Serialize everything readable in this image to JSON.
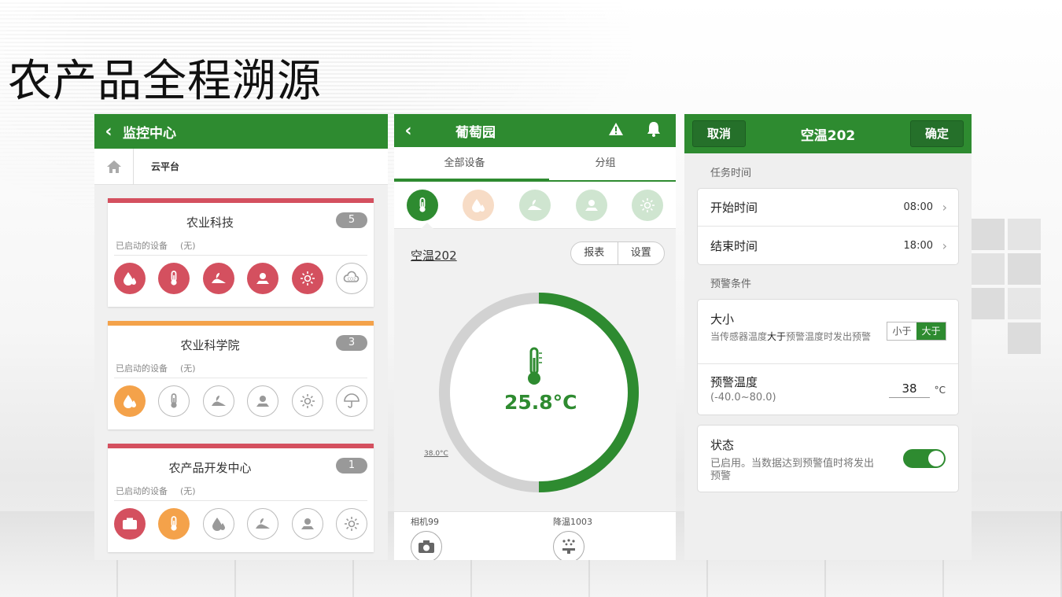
{
  "slide_title": "农产品全程溯源",
  "colors": {
    "brand_green": "#2e8b30",
    "alert_red": "#d4505f",
    "warn_orange": "#f4a24a",
    "idle_gray": "#bbbbbb"
  },
  "monitor": {
    "back_icon": "chevron-left-icon",
    "title": "监控中心",
    "breadcrumb": {
      "home_icon": "home-icon",
      "current": "云平台"
    },
    "orgs": [
      {
        "name": "农业科技",
        "count": "5",
        "sub_label": "已启动的设备",
        "sub_value": "(无)",
        "stripe": "#d4505f",
        "devices": [
          {
            "icon": "water-drop-icon",
            "state": "red"
          },
          {
            "icon": "thermometer-icon",
            "state": "red"
          },
          {
            "icon": "soil-icon",
            "state": "red"
          },
          {
            "icon": "plant-icon",
            "state": "red"
          },
          {
            "icon": "light-icon",
            "state": "red"
          },
          {
            "icon": "co2-icon",
            "state": "off"
          }
        ]
      },
      {
        "name": "农业科学院",
        "count": "3",
        "sub_label": "已启动的设备",
        "sub_value": "(无)",
        "stripe": "#f4a24a",
        "devices": [
          {
            "icon": "water-drop-icon",
            "state": "orange"
          },
          {
            "icon": "thermometer-icon",
            "state": "off"
          },
          {
            "icon": "soil-icon",
            "state": "off"
          },
          {
            "icon": "plant-icon",
            "state": "off"
          },
          {
            "icon": "light-icon",
            "state": "off"
          },
          {
            "icon": "umbrella-icon",
            "state": "off"
          }
        ]
      },
      {
        "name": "农产品开发中心",
        "count": "1",
        "sub_label": "已启动的设备",
        "sub_value": "(无)",
        "stripe": "#d4505f",
        "devices": [
          {
            "icon": "camera-icon",
            "state": "red"
          },
          {
            "icon": "thermometer-icon",
            "state": "orange"
          },
          {
            "icon": "water-drop-icon",
            "state": "off"
          },
          {
            "icon": "soil-icon",
            "state": "off"
          },
          {
            "icon": "plant-icon",
            "state": "off"
          },
          {
            "icon": "light-icon",
            "state": "off"
          }
        ]
      }
    ]
  },
  "garden": {
    "back_icon": "chevron-left-icon",
    "title": "葡萄园",
    "alert_icon": "warning-icon",
    "bell_icon": "bell-icon",
    "tabs": [
      "全部设备",
      "分组"
    ],
    "active_tab": 0,
    "device_icons": [
      {
        "icon": "thermometer-icon",
        "selected": true
      },
      {
        "icon": "water-drop-icon",
        "selected": false
      },
      {
        "icon": "soil-icon",
        "selected": false
      },
      {
        "icon": "plant-icon",
        "selected": false
      },
      {
        "icon": "light-icon",
        "selected": false
      }
    ],
    "device_name": "空温202",
    "buttons": {
      "report": "报表",
      "settings": "设置"
    },
    "gauge": {
      "value": "25.8°C",
      "limit": "38.0°C",
      "fill_fraction": 0.5
    },
    "bottom_devices": [
      {
        "label": "相机99",
        "icon": "camera-icon"
      },
      {
        "label": "降温1003",
        "icon": "sprinkler-icon"
      }
    ]
  },
  "task": {
    "cancel": "取消",
    "title": "空温202",
    "confirm": "确定",
    "section_time": "任务时间",
    "start_label": "开始时间",
    "start_value": "08:00",
    "end_label": "结束时间",
    "end_value": "18:00",
    "section_alert": "预警条件",
    "size_label": "大小",
    "size_desc_prefix": "当传感器温度",
    "size_desc_bold": "大于",
    "size_desc_suffix": "预警温度时发出预警",
    "seg_less": "小于",
    "seg_greater": "大于",
    "temp_label": "预警温度",
    "temp_range": "(-40.0~80.0)",
    "temp_value": "38",
    "temp_unit": "°C",
    "status_label": "状态",
    "status_desc": "已启用。当数据达到预警值时将发出预警",
    "status_on": true
  }
}
